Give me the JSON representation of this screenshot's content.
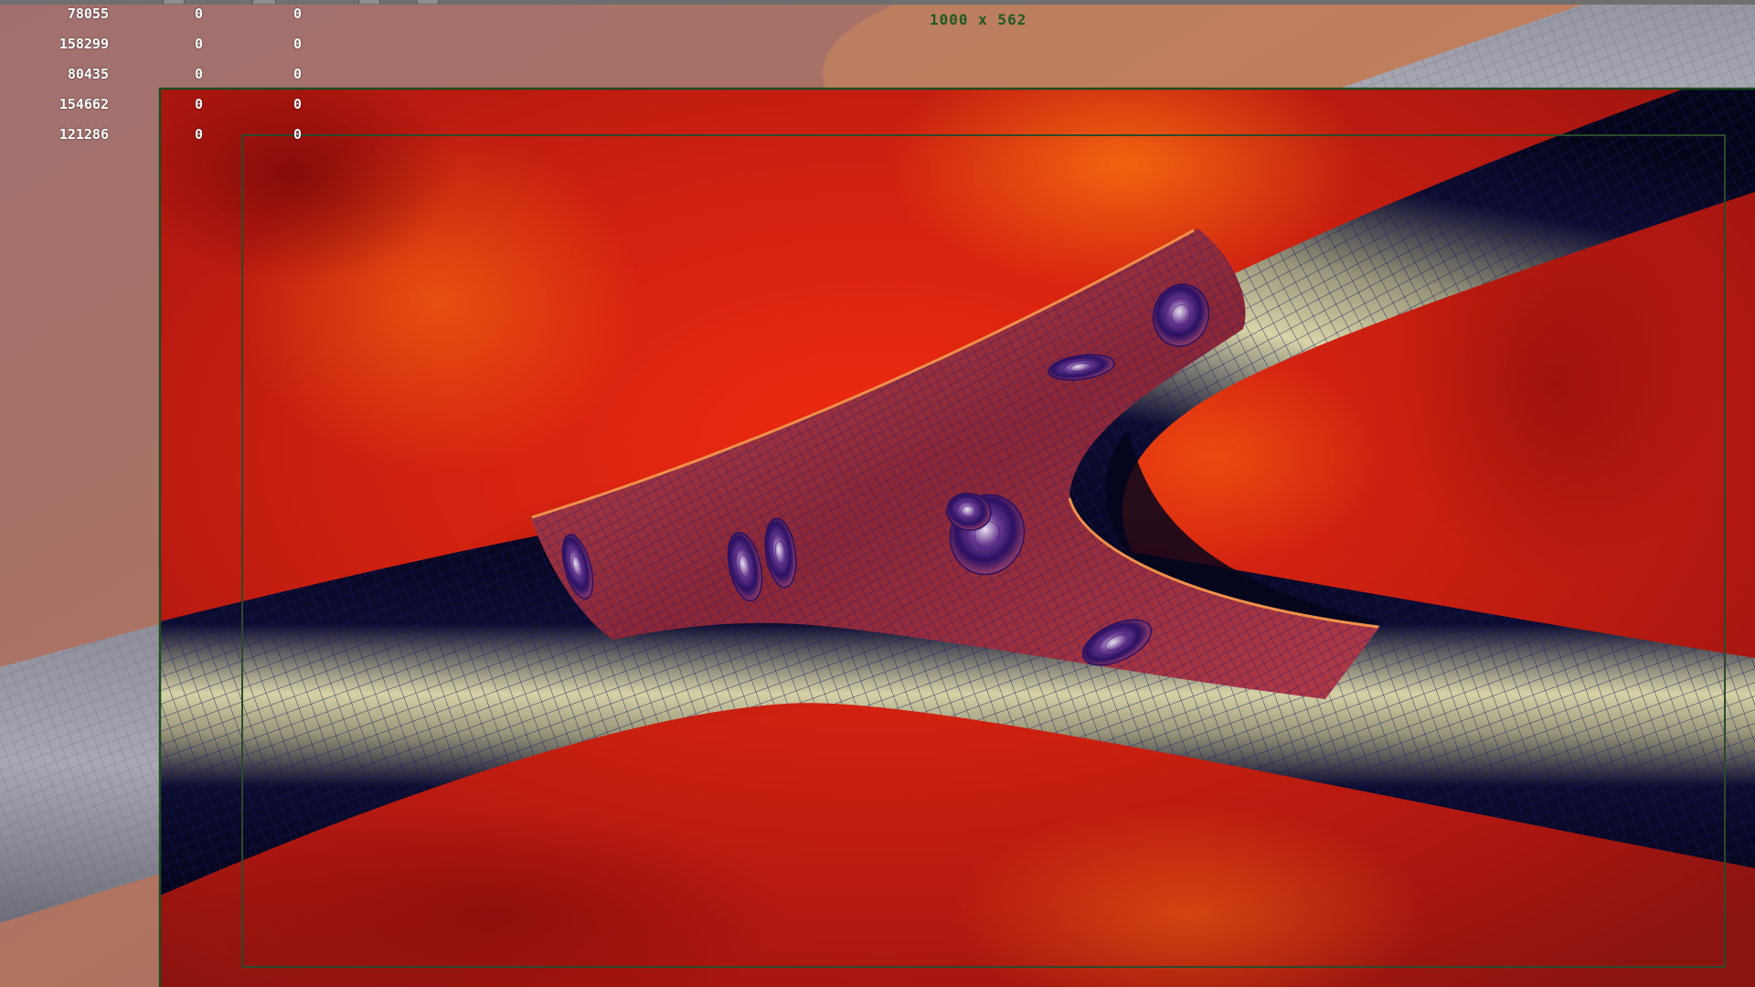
{
  "viewport": {
    "resolution_label": "1000 x 562"
  },
  "hud": {
    "rows": [
      {
        "value": "78055",
        "col2": "0",
        "col3": "0"
      },
      {
        "value": "158299",
        "col2": "0",
        "col3": "0"
      },
      {
        "value": "80435",
        "col2": "0",
        "col3": "0"
      },
      {
        "value": "154662",
        "col2": "0",
        "col3": "0"
      },
      {
        "value": "121286",
        "col2": "0",
        "col3": "0"
      }
    ]
  },
  "colors": {
    "background_red": "#d42a10",
    "vessel_mesh": "#0c0c55",
    "vessel_highlight": "#cfc99a",
    "cutaway_interior": "#9a2a3a",
    "resolution_gate": "#1f4a1f",
    "safe_frame": "#2a4a2a",
    "hud_text": "#ffffff",
    "resolution_text": "#1f5a22"
  },
  "scene": {
    "cells": [
      {
        "name": "red-blood-cell"
      },
      {
        "name": "red-blood-cell"
      },
      {
        "name": "red-blood-cell"
      },
      {
        "name": "red-blood-cell"
      },
      {
        "name": "red-blood-cell"
      },
      {
        "name": "red-blood-cell"
      },
      {
        "name": "red-blood-cell"
      },
      {
        "name": "red-blood-cell"
      }
    ]
  }
}
